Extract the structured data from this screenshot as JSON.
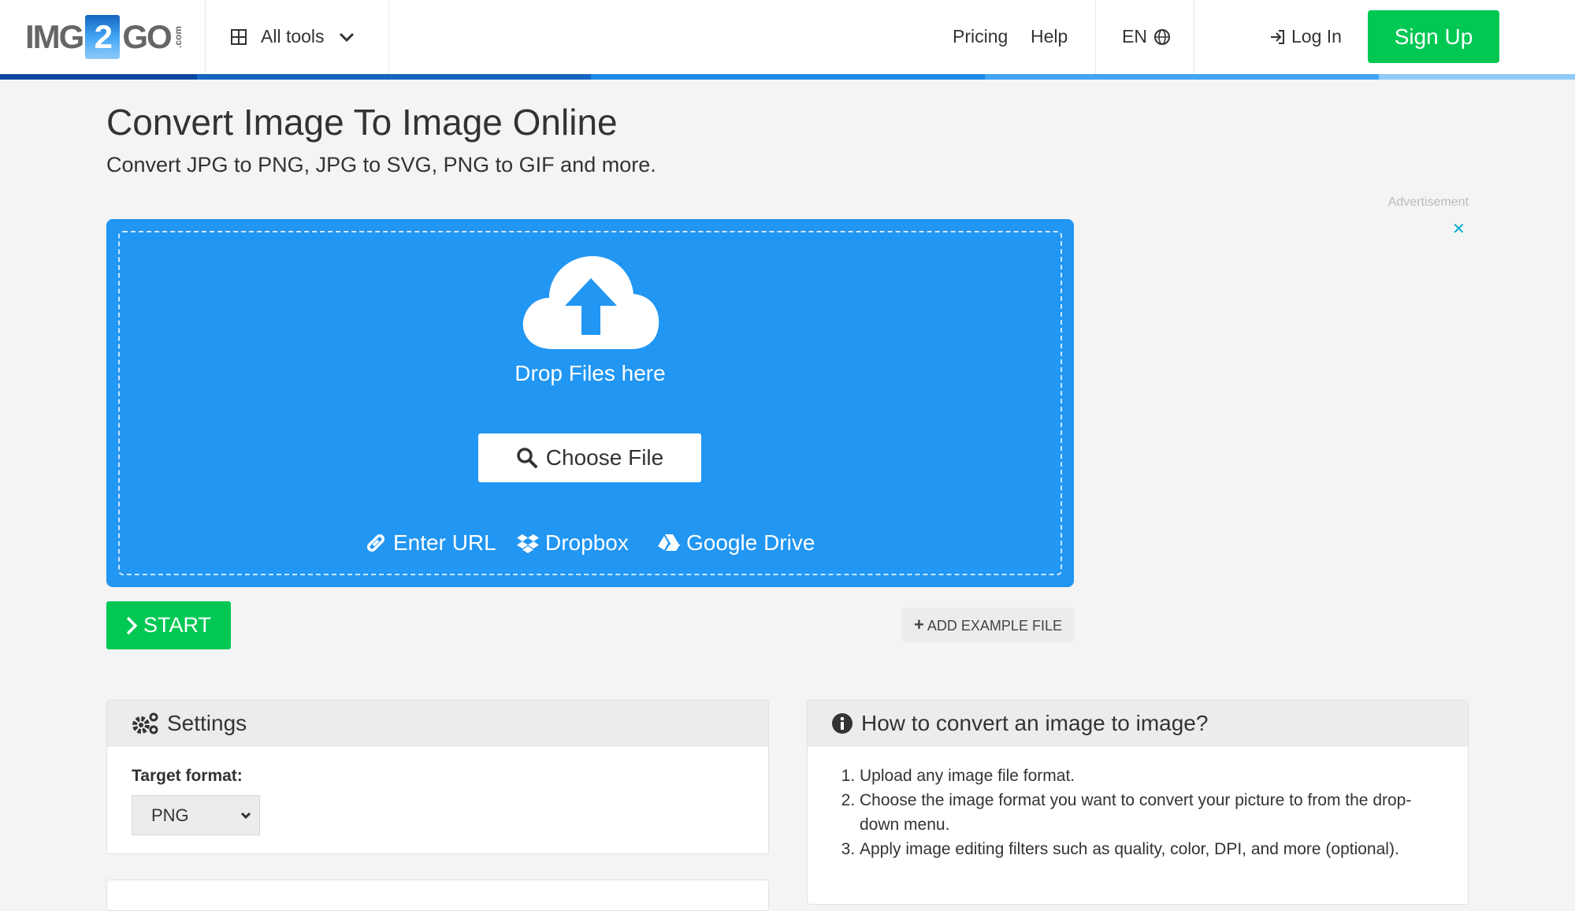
{
  "header": {
    "logo": "IMG2GO.com",
    "logo_parts": [
      "IMG",
      "2",
      "GO",
      ".com"
    ],
    "all_tools": "All tools",
    "pricing": "Pricing",
    "help": "Help",
    "language": "EN",
    "login": "Log In",
    "signup": "Sign Up"
  },
  "page": {
    "title": "Convert Image To Image Online",
    "subtitle": "Convert JPG to PNG, JPG to SVG, PNG to GIF and more."
  },
  "upload": {
    "drop_text": "Drop Files here",
    "choose_file": "Choose File",
    "enter_url": "Enter URL",
    "dropbox": "Dropbox",
    "google_drive": "Google Drive"
  },
  "actions": {
    "start": "START",
    "add_example": "ADD EXAMPLE FILE"
  },
  "ad": {
    "label": "Advertisement",
    "close": "✕"
  },
  "settings": {
    "title": "Settings",
    "target_format_label": "Target format:",
    "target_format_value": "PNG"
  },
  "howto": {
    "title": "How to convert an image to image?",
    "steps": [
      "Upload any image file format.",
      "Choose the image format you want to convert your picture to from the drop-down menu.",
      "Apply image editing filters such as quality, color, DPI, and more (optional)."
    ]
  },
  "colors": {
    "primary": "#2196f3",
    "green": "#00c853"
  }
}
